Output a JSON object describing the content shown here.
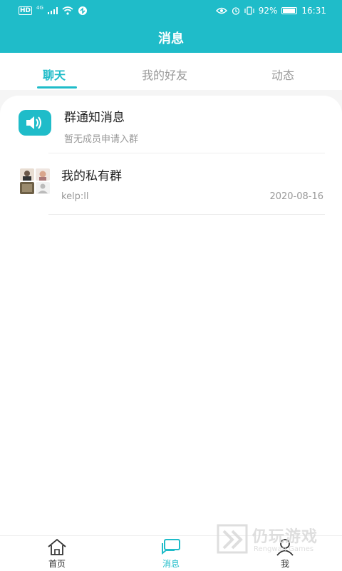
{
  "status_bar": {
    "left": {
      "hd": "HD",
      "network": "4G"
    },
    "right": {
      "battery": "92%",
      "time": "16:31"
    }
  },
  "header": {
    "title": "消息"
  },
  "tabs": [
    {
      "label": "聊天",
      "active": true
    },
    {
      "label": "我的好友",
      "active": false
    },
    {
      "label": "动态",
      "active": false
    }
  ],
  "conversations": [
    {
      "icon": "speaker-icon",
      "title": "群通知消息",
      "subtitle": "暂无成员申请入群",
      "date": ""
    },
    {
      "icon": "group-avatar",
      "title": "我的私有群",
      "subtitle": "kelp:ll",
      "date": "2020-08-16"
    }
  ],
  "bottom_nav": [
    {
      "label": "首页",
      "icon": "home-icon",
      "active": false
    },
    {
      "label": "消息",
      "icon": "message-icon",
      "active": true
    },
    {
      "label": "我",
      "icon": "user-icon",
      "active": false
    }
  ],
  "watermark": {
    "text": "仍玩游戏",
    "sub": "Rengwan Games"
  },
  "colors": {
    "accent": "#1fbcc9"
  }
}
